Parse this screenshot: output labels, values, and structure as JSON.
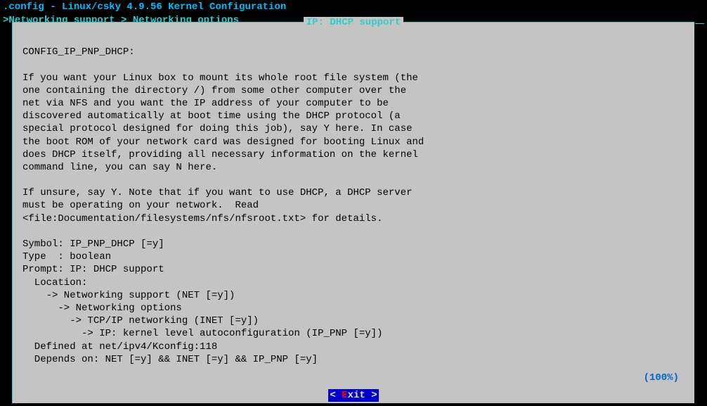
{
  "title": ".config - Linux/csky 4.9.56 Kernel Configuration",
  "breadcrumb": {
    "prefix": "> ",
    "path": "Networking support > Networking options"
  },
  "dialog": {
    "title": " IP: DHCP support ",
    "config_name": "CONFIG_IP_PNP_DHCP:",
    "description": "If you want your Linux box to mount its whole root file system (the\none containing the directory /) from some other computer over the\nnet via NFS and you want the IP address of your computer to be\ndiscovered automatically at boot time using the DHCP protocol (a\nspecial protocol designed for doing this job), say Y here. In case\nthe boot ROM of your network card was designed for booting Linux and\ndoes DHCP itself, providing all necessary information on the kernel\ncommand line, you can say N here.",
    "note": "If unsure, say Y. Note that if you want to use DHCP, a DHCP server\nmust be operating on your network.  Read\n<file:Documentation/filesystems/nfs/nfsroot.txt> for details.",
    "symbol": "Symbol: IP_PNP_DHCP [=y]",
    "type": "Type  : boolean",
    "prompt": "Prompt: IP: DHCP support",
    "location_label": "  Location:",
    "location1": "    -> Networking support (NET [=y])",
    "location2": "      -> Networking options",
    "location3": "        -> TCP/IP networking (INET [=y])",
    "location4": "          -> IP: kernel level autoconfiguration (IP_PNP [=y])",
    "defined_at": "  Defined at net/ipv4/Kconfig:118",
    "depends_on": "  Depends on: NET [=y] && INET [=y] && IP_PNP [=y]",
    "percent": "(100%)"
  },
  "button": {
    "bracket_open": "< ",
    "hotkey": "E",
    "rest": "xit ",
    "bracket_close": ">"
  }
}
